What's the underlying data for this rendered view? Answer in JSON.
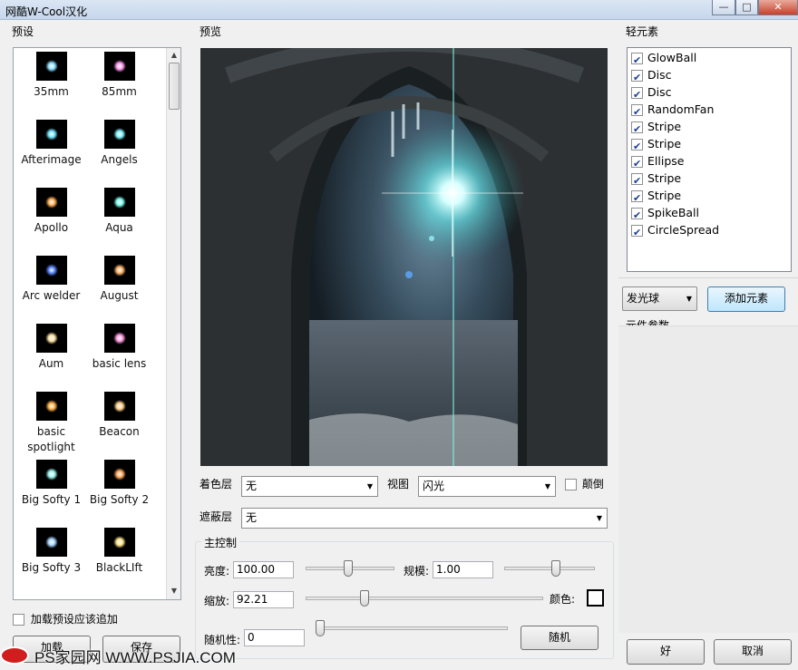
{
  "window": {
    "title": "网酷W-Cool汉化",
    "min_label": "—",
    "max_label": "□",
    "close_label": "✕"
  },
  "presets": {
    "caption": "预设",
    "items": [
      {
        "label": "35mm",
        "color": "#8fe0ff"
      },
      {
        "label": "85mm",
        "color": "#ff9cf0"
      },
      {
        "label": "Afterimage",
        "color": "#70e6ff"
      },
      {
        "label": "Angels",
        "color": "#7ff5ff"
      },
      {
        "label": "Apollo",
        "color": "#ffae58"
      },
      {
        "label": "Aqua",
        "color": "#7ffff0"
      },
      {
        "label": "Arc welder",
        "color": "#5a86ff"
      },
      {
        "label": "August",
        "color": "#ffb46a"
      },
      {
        "label": "Aum",
        "color": "#ffe2a6"
      },
      {
        "label": "basic lens",
        "color": "#ff9be3"
      },
      {
        "label": "basic spotlight",
        "color": "#ffb347"
      },
      {
        "label": "Beacon",
        "color": "#ffd08a"
      },
      {
        "label": "Big Softy 1",
        "color": "#9ff4f1"
      },
      {
        "label": "Big Softy 2",
        "color": "#ffa95e"
      },
      {
        "label": "Big Softy 3",
        "color": "#a8d5ff"
      },
      {
        "label": "BlackLIft",
        "color": "#ffe68a"
      }
    ],
    "append_label": "加载预设应该追加",
    "load_label": "加载",
    "save_label": "保存"
  },
  "preview": {
    "caption": "预览"
  },
  "controls": {
    "color_layer_label": "着色层",
    "color_layer_value": "无",
    "view_label": "视图",
    "view_value": "闪光",
    "invert_label": "颠倒",
    "mask_layer_label": "遮蔽层",
    "mask_layer_value": "无",
    "main_caption": "主控制",
    "brightness_label": "亮度:",
    "brightness_value": "100.00",
    "scale_label": "规模:",
    "scale_value": "1.00",
    "zoom_label": "缩放:",
    "zoom_value": "92.21",
    "color_label": "颜色:",
    "random_label": "随机性:",
    "random_value": "0",
    "random_button": "随机",
    "brightness_level": 0.48,
    "scale_level": 0.58,
    "zoom_level": 0.24,
    "random_level": 0.0
  },
  "elements": {
    "caption": "轻元素",
    "items": [
      {
        "label": "GlowBall",
        "checked": true
      },
      {
        "label": "Disc",
        "checked": true
      },
      {
        "label": "Disc",
        "checked": true
      },
      {
        "label": "RandomFan",
        "checked": true
      },
      {
        "label": "Stripe",
        "checked": true
      },
      {
        "label": "Stripe",
        "checked": true
      },
      {
        "label": "Ellipse",
        "checked": true
      },
      {
        "label": "Stripe",
        "checked": true
      },
      {
        "label": "Stripe",
        "checked": true
      },
      {
        "label": "SpikeBall",
        "checked": true
      },
      {
        "label": "CircleSpread",
        "checked": true
      }
    ],
    "type_value": "发光球",
    "add_label": "添加元素",
    "params_caption": "元件参数"
  },
  "footer": {
    "ok_label": "好",
    "cancel_label": "取消"
  },
  "watermark": {
    "text": "PS家园网 WWW.PSJIA.COM"
  }
}
